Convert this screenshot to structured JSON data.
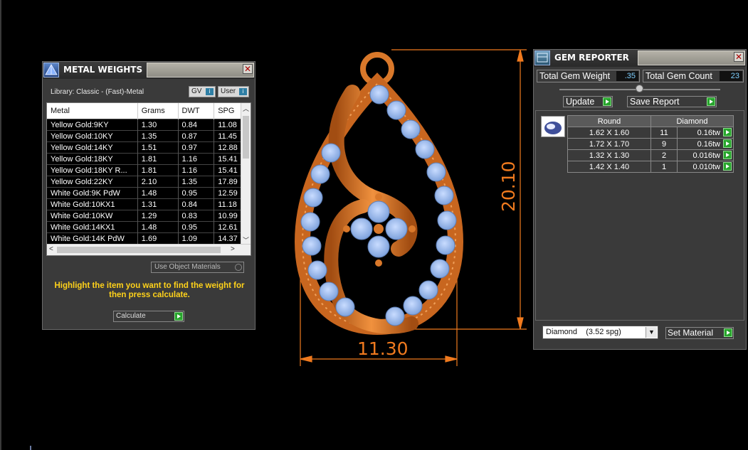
{
  "metal_weights": {
    "title": "METAL WEIGHTS",
    "library": "Library: Classic - (Fast)-Metal",
    "sel1": "GV",
    "sel2": "User",
    "columns": [
      "Metal",
      "Grams",
      "DWT",
      "SPG"
    ],
    "rows": [
      [
        "Yellow Gold:9KY",
        "1.30",
        "0.84",
        "11.08"
      ],
      [
        "Yellow Gold:10KY",
        "1.35",
        "0.87",
        "11.45"
      ],
      [
        "Yellow Gold:14KY",
        "1.51",
        "0.97",
        "12.88"
      ],
      [
        "Yellow Gold:18KY",
        "1.81",
        "1.16",
        "15.41"
      ],
      [
        "Yellow Gold:18KY R...",
        "1.81",
        "1.16",
        "15.41"
      ],
      [
        "Yellow Gold:22KY",
        "2.10",
        "1.35",
        "17.89"
      ],
      [
        "White Gold:9K PdW",
        "1.48",
        "0.95",
        "12.59"
      ],
      [
        "White Gold:10KX1",
        "1.31",
        "0.84",
        "11.18"
      ],
      [
        "White Gold:10KW",
        "1.29",
        "0.83",
        "10.99"
      ],
      [
        "White Gold:14KX1",
        "1.48",
        "0.95",
        "12.61"
      ],
      [
        "White Gold:14K PdW",
        "1.69",
        "1.09",
        "14.37"
      ]
    ],
    "use_object_materials": "Use Object Materials",
    "hint": "Highlight the item you want to find the weight for then press calculate.",
    "calculate": "Calculate"
  },
  "gem_reporter": {
    "title": "GEM REPORTER",
    "total_weight_label": "Total Gem Weight",
    "total_weight_value": ".35",
    "total_count_label": "Total Gem Count",
    "total_count_value": "23",
    "update": "Update",
    "save_report": "Save Report",
    "header": [
      "Round",
      "Diamond"
    ],
    "rows": [
      [
        "1.62 X 1.60",
        "11",
        "0.16tw"
      ],
      [
        "1.72 X 1.70",
        "9",
        "0.16tw"
      ],
      [
        "1.32 X 1.30",
        "2",
        "0.016tw"
      ],
      [
        "1.42 X 1.40",
        "1",
        "0.010tw"
      ]
    ],
    "material": "Diamond    (3.52 spg)",
    "set_material": "Set Material"
  },
  "dimensions": {
    "width": "11.30",
    "height": "20.10"
  },
  "colors": {
    "metal": "#e07b2a",
    "gem": "#8fb2e8",
    "dimension": "#f07a1e",
    "hint": "#ffd21a"
  }
}
